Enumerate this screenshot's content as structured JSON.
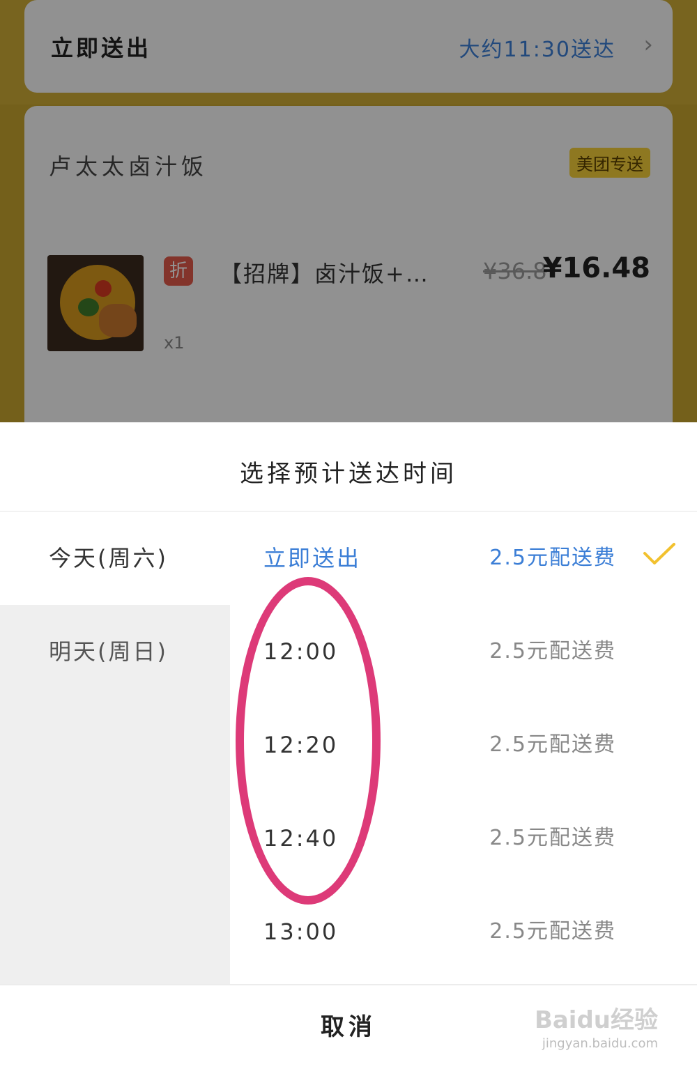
{
  "order": {
    "delivery_label": "立即送出",
    "eta_text": "大约11:30送达",
    "shop_name": "卢太太卤汁饭",
    "delivery_tag": "美团专送",
    "item": {
      "discount_badge": "折",
      "name": "【招牌】卤汁饭+…",
      "original_price": "¥36.8",
      "price": "¥16.48",
      "quantity": "x1"
    }
  },
  "sheet": {
    "title": "选择预计送达时间",
    "days": [
      {
        "label": "今天(周六)"
      },
      {
        "label": "明天(周日)"
      }
    ],
    "slots": [
      {
        "time": "立即送出",
        "fee": "2.5元配送费"
      },
      {
        "time": "12:00",
        "fee": "2.5元配送费"
      },
      {
        "time": "12:20",
        "fee": "2.5元配送费"
      },
      {
        "time": "12:40",
        "fee": "2.5元配送费"
      },
      {
        "time": "13:00",
        "fee": "2.5元配送费"
      }
    ],
    "cancel_label": "取消"
  },
  "watermark": {
    "main": "Baidu经验",
    "sub": "jingyan.baidu.com"
  },
  "colors": {
    "accent_blue": "#3b7ed6",
    "check_yellow": "#f2c12e",
    "highlight_ellipse": "#dd3a78"
  }
}
